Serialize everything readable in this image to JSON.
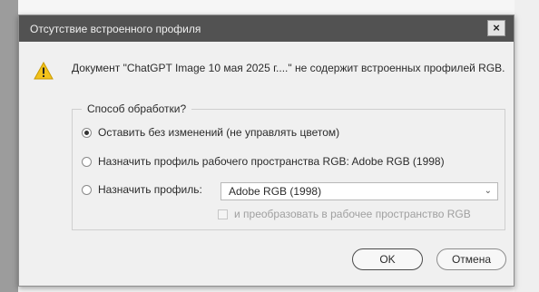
{
  "dialog": {
    "title": "Отсутствие встроенного профиля",
    "close_glyph": "×",
    "message": "Документ \"ChatGPT Image 10 мая 2025 г....\" не содержит встроенных профилей RGB."
  },
  "options": {
    "legend": "Способ обработки?",
    "leave_unchanged": "Оставить без изменений (не управлять цветом)",
    "assign_working": "Назначить профиль рабочего пространства RGB:  Adobe RGB (1998)",
    "assign_profile": "Назначить профиль:",
    "profile_select_value": "Adobe RGB (1998)",
    "convert_checkbox": "и преобразовать в рабочее пространство RGB",
    "selected": "leave_unchanged"
  },
  "buttons": {
    "ok": "OK",
    "cancel": "Отмена"
  },
  "colors": {
    "titlebar": "#525252",
    "dialog_bg": "#f0f0f0",
    "warning_icon": "#f2c21b"
  }
}
